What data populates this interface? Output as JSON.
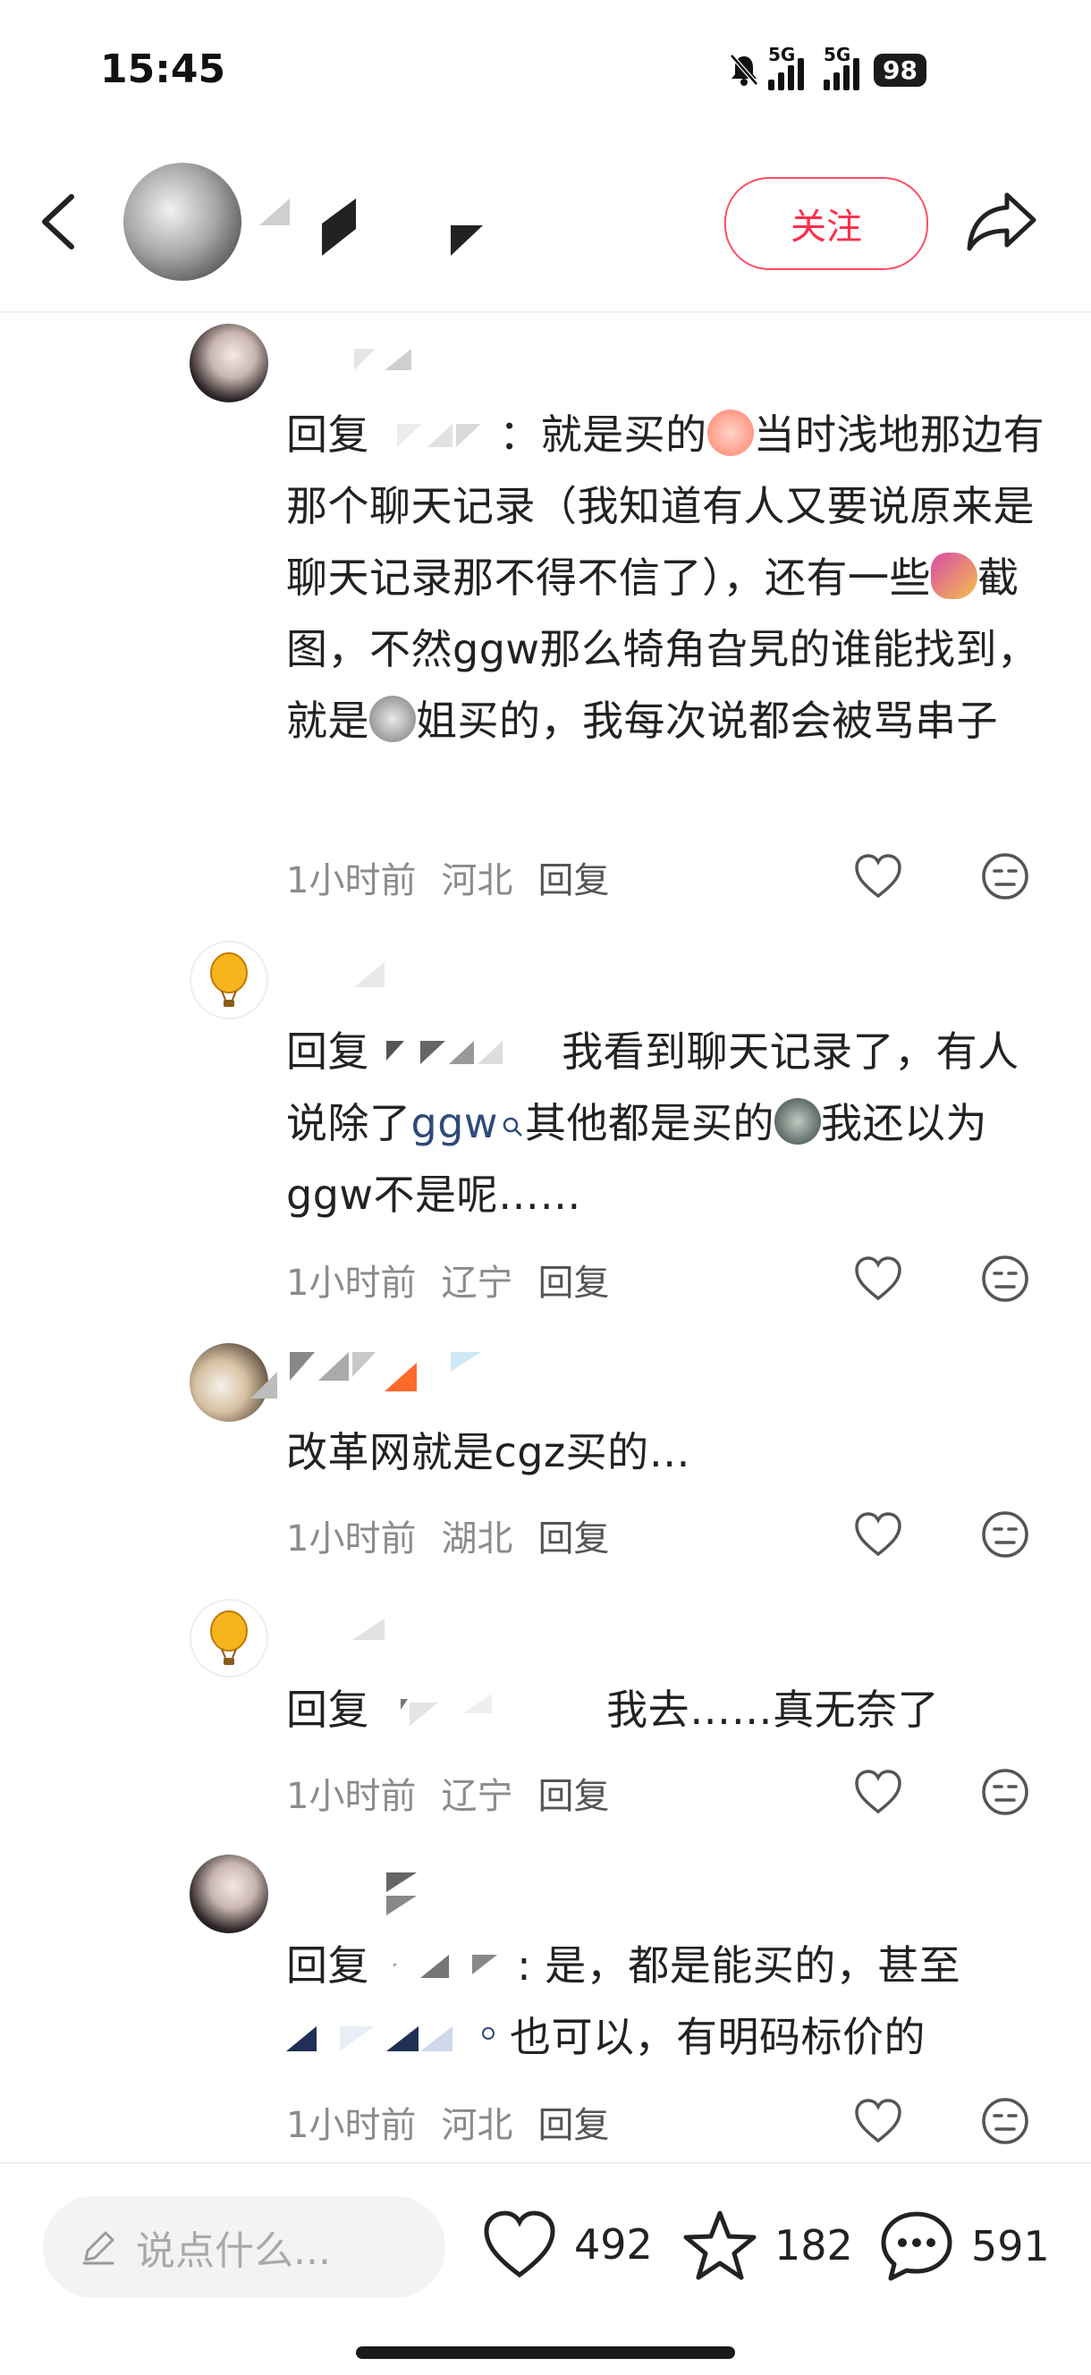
{
  "status_bar": {
    "time": "15:45",
    "network1": "5G",
    "network2": "5G",
    "battery": "98"
  },
  "header": {
    "follow_label": "关注"
  },
  "comments": [
    {
      "text_a": "回复",
      "text_b": "：就是买的",
      "text_c": "当时浅地那边有那个聊天记录（我知道有人又要说原来是聊天记录那不得不信了），还有一些",
      "text_d": "截图，不然ggw那么犄角旮旯的谁能找到，就是",
      "text_e": "姐买的，我每次说都会被骂串子",
      "time": "1小时前",
      "location": "河北",
      "reply": "回复"
    },
    {
      "text_a": "回复",
      "text_b": "我看到聊天记录了，有人说除了",
      "link": "ggw",
      "text_c": "其他都是买的",
      "text_d": "我还以为ggw不是呢……",
      "time": "1小时前",
      "location": "辽宁",
      "reply": "回复"
    },
    {
      "text": "改革网就是cgz买的…",
      "time": "1小时前",
      "location": "湖北",
      "reply": "回复"
    },
    {
      "text_a": "回复",
      "text_b": "我去……真无奈了",
      "time": "1小时前",
      "location": "辽宁",
      "reply": "回复"
    },
    {
      "text_a": "回复",
      "text_b": ": 是，都是能买的，甚至",
      "text_c": "也可以，有明码标价的",
      "time": "1小时前",
      "location": "河北",
      "reply": "回复"
    }
  ],
  "bottom_bar": {
    "input_placeholder": "说点什么...",
    "likes": "492",
    "favorites": "182",
    "comments": "591"
  },
  "colors": {
    "accent": "#ff2e4d",
    "meta_gray": "#8b8b8b",
    "link_blue": "#2f4a7a"
  }
}
